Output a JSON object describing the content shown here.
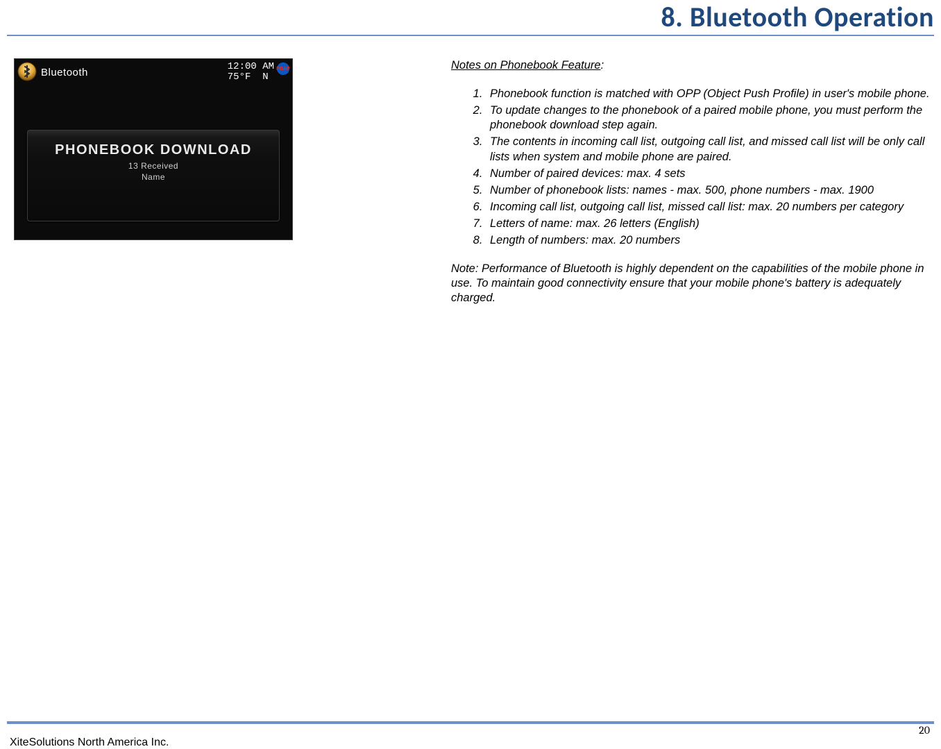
{
  "header": {
    "title": "8. Bluetooth Operation"
  },
  "device": {
    "status": {
      "app_title": "Bluetooth",
      "time": "12:00 AM",
      "temp": "75°F",
      "direction": "N",
      "badge_label": "PBAP"
    },
    "panel": {
      "title": "PHONEBOOK DOWNLOAD",
      "line1": "13 Received",
      "line2": "Name"
    }
  },
  "doc": {
    "notes_heading": "Notes on Phonebook Feature",
    "notes_colon": ":",
    "items": [
      "Phonebook function is matched with OPP (Object Push Profile) in user's mobile phone.",
      "To update changes to the phonebook of a paired mobile phone, you must perform the phonebook download step again.",
      "The contents in incoming call list, outgoing call list, and missed call list will be only call lists when system and mobile phone are paired.",
      "Number of paired devices: max. 4 sets",
      "Number of phonebook lists: names - max. 500, phone numbers - max. 1900",
      "Incoming call list, outgoing call list, missed call list: max. 20 numbers per category",
      "Letters of name: max. 26 letters (English)",
      "Length of numbers: max. 20 numbers"
    ],
    "foot_note": "Note: Performance of Bluetooth is highly dependent on the capabilities of the mobile phone in use. To maintain good connectivity ensure that your mobile phone's battery is adequately charged."
  },
  "footer": {
    "company": "XiteSolutions North America Inc.",
    "page": "20"
  }
}
